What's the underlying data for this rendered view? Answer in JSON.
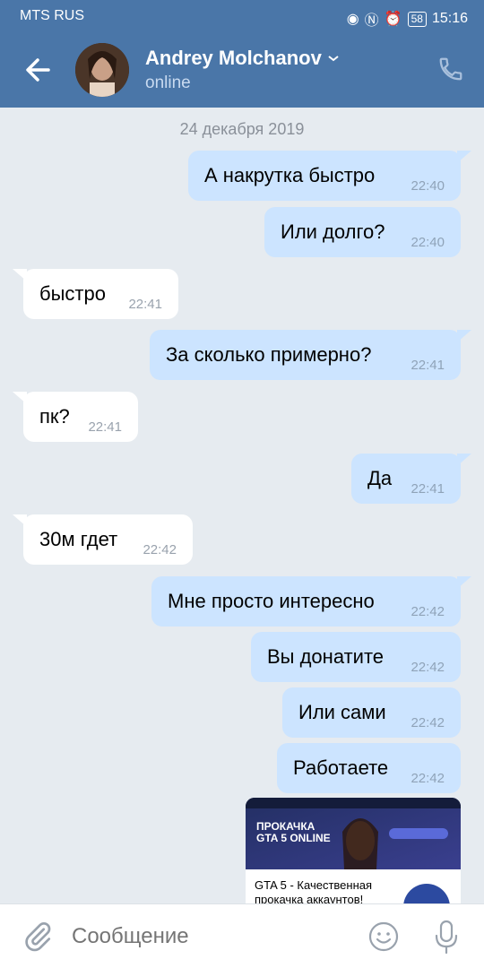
{
  "status_bar": {
    "carrier": "MTS RUS",
    "battery": "58",
    "time": "15:16"
  },
  "header": {
    "name": "Andrey Molchanov",
    "status": "online"
  },
  "date_separator": "24 декабря 2019",
  "messages": [
    {
      "text": "А накрутка быстро",
      "time": "22:40",
      "dir": "out"
    },
    {
      "text": "Или долго?",
      "time": "22:40",
      "dir": "out"
    },
    {
      "text": "быстро",
      "time": "22:41",
      "dir": "in"
    },
    {
      "text": "За сколько примерно?",
      "time": "22:41",
      "dir": "out"
    },
    {
      "text": "пк?",
      "time": "22:41",
      "dir": "in"
    },
    {
      "text": "Да",
      "time": "22:41",
      "dir": "out"
    },
    {
      "text": "30м гдет",
      "time": "22:42",
      "dir": "in"
    },
    {
      "text": "Мне просто интересно",
      "time": "22:42",
      "dir": "out"
    },
    {
      "text": "Вы донатите",
      "time": "22:42",
      "dir": "out"
    },
    {
      "text": "Или сами",
      "time": "22:42",
      "dir": "out"
    },
    {
      "text": "Работаете",
      "time": "22:42",
      "dir": "out"
    }
  ],
  "attachment": {
    "title": "GTA 5 - Качественная прокачка аккаунтов!",
    "banner_line1": "ПРОКАЧКА",
    "banner_line2": "GTA 5 ONLINE"
  },
  "input": {
    "placeholder": "Сообщение"
  },
  "colors": {
    "header": "#4a76a8",
    "out_bubble": "#cce4ff",
    "in_bubble": "#ffffff",
    "background": "#e6ebf0"
  }
}
